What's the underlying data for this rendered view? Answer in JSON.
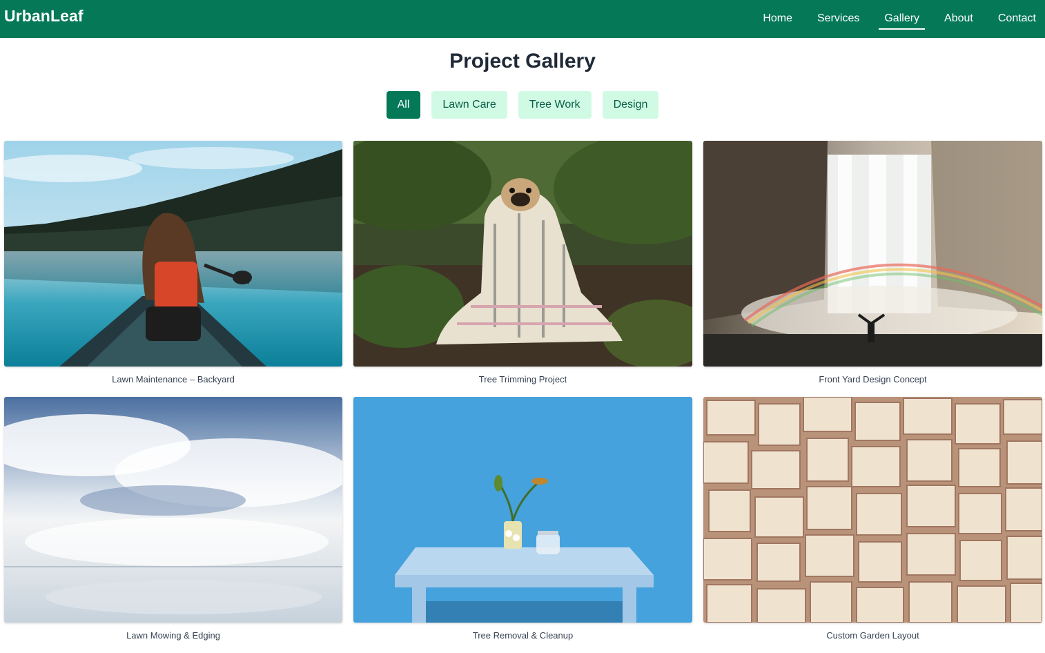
{
  "header": {
    "brand": "UrbanLeaf",
    "nav": [
      "Home",
      "Services",
      "Gallery",
      "About",
      "Contact"
    ],
    "active_nav": "Gallery"
  },
  "main": {
    "title": "Project Gallery",
    "filters": [
      "All",
      "Lawn Care",
      "Tree Work",
      "Design"
    ],
    "active_filter": "All"
  },
  "gallery": {
    "items": [
      {
        "caption": "Lawn Maintenance – Backyard",
        "image": "canoe-lake-photo"
      },
      {
        "caption": "Tree Trimming Project",
        "image": "pug-blanket-forest-photo"
      },
      {
        "caption": "Front Yard Design Concept",
        "image": "waterfall-rainbow-photo"
      },
      {
        "caption": "Lawn Mowing & Edging",
        "image": "cloud-reflection-photo"
      },
      {
        "caption": "Tree Removal & Cleanup",
        "image": "blue-table-plant-photo"
      },
      {
        "caption": "Custom Garden Layout",
        "image": "open-books-wall-photo"
      }
    ]
  },
  "colors": {
    "header_bg": "#047857",
    "filter_active_bg": "#047857",
    "filter_bg": "#d1fae5",
    "filter_text": "#065f46"
  }
}
